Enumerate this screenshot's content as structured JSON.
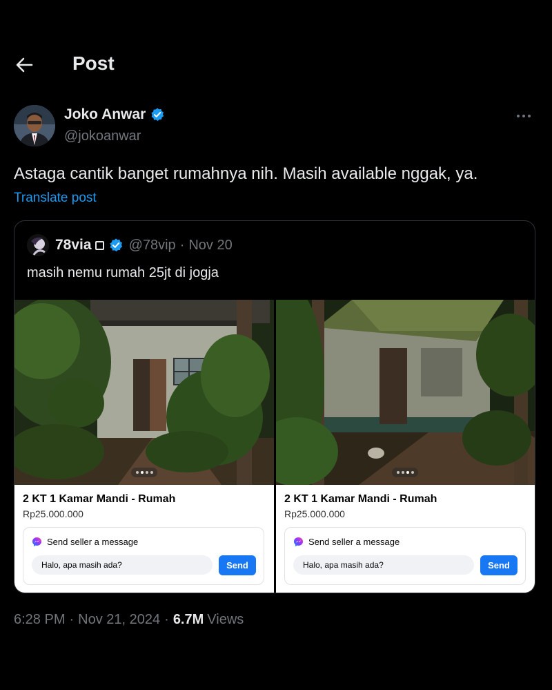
{
  "header": {
    "title": "Post",
    "back_icon": "arrow-left-icon"
  },
  "author": {
    "name": "Joko Anwar",
    "handle": "@jokoanwar",
    "verified": true,
    "verified_color": "#1d9bf0",
    "more_icon": "more-horizontal-icon"
  },
  "post": {
    "text": "Astaga cantik banget rumahnya nih. Masih available nggak, ya.",
    "translate_label": "Translate post"
  },
  "quote": {
    "name": "78via",
    "handle": "@78vip",
    "separator": "·",
    "date": "Nov 20",
    "text": "masih nemu rumah 25jt di jogja",
    "listings": [
      {
        "title": "2 KT 1 Kamar Mandi - Rumah",
        "price": "Rp25.000.000",
        "message_label": "Send seller a message",
        "message_value": "Halo, apa masih ada?",
        "send_label": "Send",
        "carousel_active_dot": 2
      },
      {
        "title": "2 KT 1 Kamar Mandi - Rumah",
        "price": "Rp25.000.000",
        "message_label": "Send seller a message",
        "message_value": "Halo, apa masih ada?",
        "send_label": "Send",
        "carousel_active_dot": 3
      }
    ]
  },
  "meta": {
    "time": "6:28 PM",
    "separator": "·",
    "date": "Nov 21, 2024",
    "views_count": "6.7M",
    "views_label": "Views"
  },
  "colors": {
    "background": "#000000",
    "text_primary": "#e7e9ea",
    "text_secondary": "#71767b",
    "link": "#1d9bf0",
    "send_button": "#1877f2"
  }
}
